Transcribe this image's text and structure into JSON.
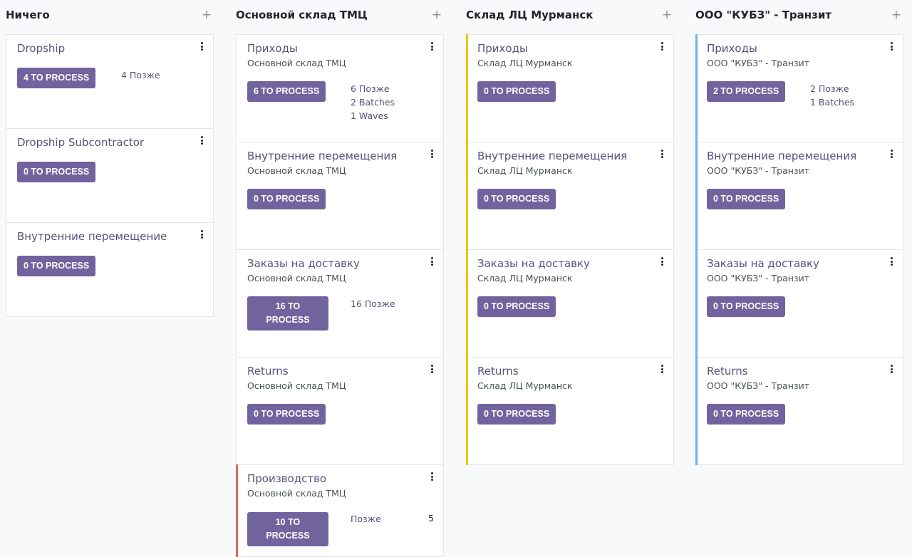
{
  "colors": {
    "button": "#71639e",
    "link": "#59507a",
    "accent_yellow": "#f1c40f",
    "accent_blue": "#6cb4e4",
    "accent_red": "#e06a5c"
  },
  "columns": [
    {
      "title": "Ничего",
      "cards": [
        {
          "title": "Dropship",
          "subtitle": "",
          "button": "4 TO PROCESS",
          "links": [
            "4 Позже"
          ]
        },
        {
          "title": "Dropship Subcontractor",
          "subtitle": "",
          "button": "0 TO PROCESS",
          "links": []
        },
        {
          "title": "Внутренние перемещение",
          "subtitle": "",
          "button": "0 TO PROCESS",
          "links": []
        }
      ]
    },
    {
      "title": "Основной склад ТМЦ",
      "cards": [
        {
          "title": "Приходы",
          "subtitle": "Основной склад ТМЦ",
          "button": "6 TO PROCESS",
          "links": [
            "6 Позже",
            "2 Batches",
            "1 Waves"
          ]
        },
        {
          "title": "Внутренние перемещения",
          "subtitle": "Основной склад ТМЦ",
          "button": "0 TO PROCESS",
          "links": []
        },
        {
          "title": "Заказы на доставку",
          "subtitle": "Основной склад ТМЦ",
          "button": "16 TO PROCESS",
          "links": [
            "16 Позже"
          ]
        },
        {
          "title": "Returns",
          "subtitle": "Основной склад ТМЦ",
          "button": "0 TO PROCESS",
          "links": []
        },
        {
          "title": "Производство",
          "subtitle": "Основной склад ТМЦ",
          "button": "10 TO PROCESS",
          "links": [
            "Позже"
          ],
          "late_count": "5"
        }
      ]
    },
    {
      "title": "Склад ЛЦ Мурманск",
      "cards": [
        {
          "title": "Приходы",
          "subtitle": "Склад ЛЦ Мурманск",
          "button": "0 TO PROCESS",
          "links": []
        },
        {
          "title": "Внутренние перемещения",
          "subtitle": "Склад ЛЦ Мурманск",
          "button": "0 TO PROCESS",
          "links": []
        },
        {
          "title": "Заказы на доставку",
          "subtitle": "Склад ЛЦ Мурманск",
          "button": "0 TO PROCESS",
          "links": []
        },
        {
          "title": "Returns",
          "subtitle": "Склад ЛЦ Мурманск",
          "button": "0 TO PROCESS",
          "links": []
        }
      ]
    },
    {
      "title": "ООО \"КУБЗ\" - Транзит",
      "cards": [
        {
          "title": "Приходы",
          "subtitle": "ООО \"КУБЗ\" - Транзит",
          "button": "2 TO PROCESS",
          "links": [
            "2 Позже",
            "1 Batches"
          ]
        },
        {
          "title": "Внутренние перемещения",
          "subtitle": "ООО \"КУБЗ\" - Транзит",
          "button": "0 TO PROCESS",
          "links": []
        },
        {
          "title": "Заказы на доставку",
          "subtitle": "ООО \"КУБЗ\" - Транзит",
          "button": "0 TO PROCESS",
          "links": []
        },
        {
          "title": "Returns",
          "subtitle": "ООО \"КУБЗ\" - Транзит",
          "button": "0 TO PROCESS",
          "links": []
        }
      ]
    }
  ]
}
